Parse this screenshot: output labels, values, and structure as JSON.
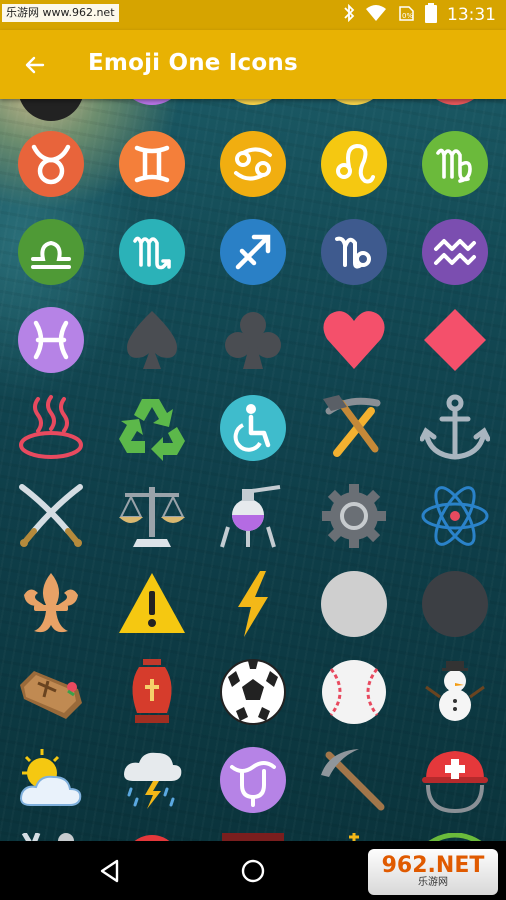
{
  "status_bar": {
    "watermark": "乐游网 www.962.net",
    "time": "13:31",
    "icons": [
      "bluetooth-icon",
      "wifi-icon",
      "no-sim-icon",
      "battery-icon"
    ]
  },
  "app_bar": {
    "title": "Emoji One Icons",
    "back_icon": "arrow-back-icon",
    "background_color": "#e8b203"
  },
  "icon_grid": {
    "rows": [
      [
        "aries-partial",
        "virgo-partial-purple",
        "yellow-partial",
        "yellow-partial",
        "red-partial"
      ],
      [
        "taurus",
        "gemini",
        "cancer",
        "leo",
        "virgo"
      ],
      [
        "libra",
        "scorpius",
        "sagittarius",
        "capricorn",
        "aquarius"
      ],
      [
        "pisces",
        "spade-suit",
        "club-suit",
        "heart-suit",
        "diamond-suit"
      ],
      [
        "hot-springs",
        "recycling",
        "wheelchair",
        "hammer-and-pick",
        "anchor"
      ],
      [
        "crossed-swords",
        "scales",
        "alembic",
        "gear",
        "atom"
      ],
      [
        "fleur-de-lis",
        "warning",
        "high-voltage",
        "white-circle",
        "black-circle"
      ],
      [
        "coffin",
        "funeral-urn",
        "soccer-ball",
        "baseball",
        "snowman"
      ],
      [
        "sun-behind-cloud",
        "cloud-with-lightning-and-rain",
        "ophiuchus",
        "pick",
        "rescue-worker-helmet"
      ]
    ]
  },
  "nav_bar": {
    "back_icon": "nav-back-icon",
    "home_icon": "nav-home-icon",
    "watermark_big": "962.NET",
    "watermark_small": "乐游网"
  }
}
